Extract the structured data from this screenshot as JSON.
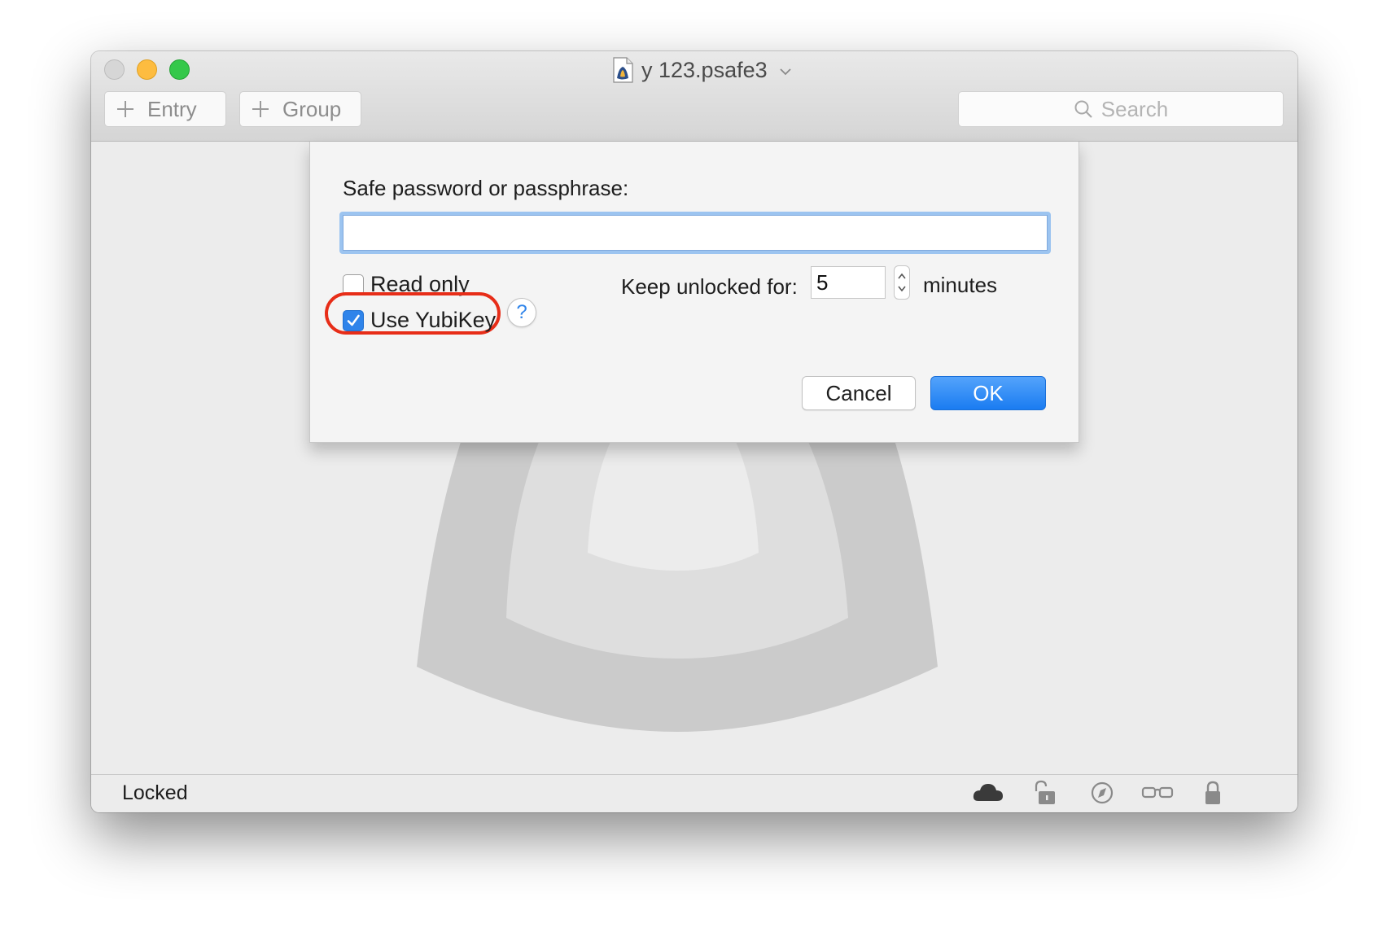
{
  "window": {
    "title": "y 123.psafe3",
    "icons": {
      "document": "document-icon",
      "title_menu": "chevron-down-icon"
    }
  },
  "toolbar": {
    "entry_label": "Entry",
    "group_label": "Group",
    "search_placeholder": "Search",
    "icons": {
      "add": "plus-icon",
      "search": "search-icon"
    }
  },
  "dialog": {
    "password_label": "Safe password or passphrase:",
    "password_value": "",
    "read_only": {
      "label": "Read only",
      "checked": false
    },
    "use_yubikey": {
      "label": "Use YubiKey",
      "checked": true,
      "highlight_color": "#e72d18"
    },
    "help_label": "?",
    "keep_unlocked_label": "Keep unlocked for:",
    "keep_unlocked_value": "5",
    "minutes_label": "minutes",
    "cancel_label": "Cancel",
    "ok_label": "OK"
  },
  "statusbar": {
    "status": "Locked",
    "icons": [
      "cloud-icon",
      "unlock-icon",
      "compass-icon",
      "glasses-icon",
      "lock-icon"
    ]
  },
  "colors": {
    "accent": "#2f84ea",
    "focus_ring": "#9cc4f0",
    "highlight": "#e72d18",
    "traffic_close": "#d6d6d6",
    "traffic_minimize": "#fdbc40",
    "traffic_maximize": "#34c84a"
  }
}
